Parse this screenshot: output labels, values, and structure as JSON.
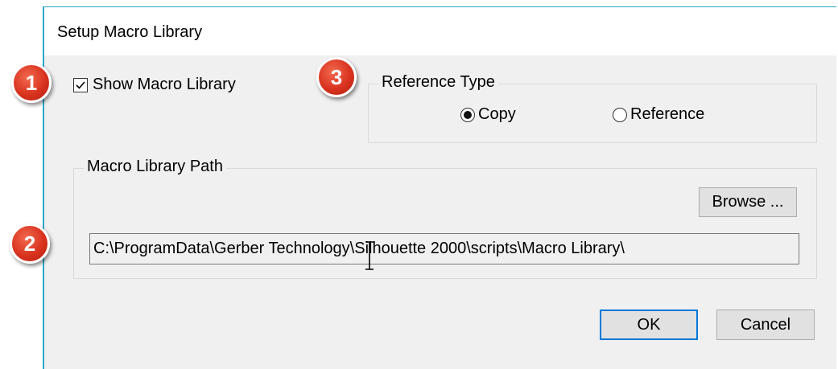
{
  "dialog": {
    "title": "Setup Macro Library"
  },
  "show_macro_library": {
    "label": "Show Macro Library",
    "checked": true
  },
  "reference_type": {
    "group_label": "Reference Type",
    "options": [
      "Copy",
      "Reference"
    ],
    "selected": "Copy"
  },
  "macro_library_path": {
    "group_label": "Macro Library Path",
    "browse_label": "Browse ...",
    "path_value": "C:\\ProgramData\\Gerber Technology\\Silhouette 2000\\scripts\\Macro Library\\"
  },
  "buttons": {
    "ok_label": "OK",
    "cancel_label": "Cancel"
  },
  "callouts": [
    "1",
    "2",
    "3"
  ],
  "colors": {
    "accent": "#0078d7",
    "callout": "#d9331f",
    "window_border": "#29a9c9"
  }
}
